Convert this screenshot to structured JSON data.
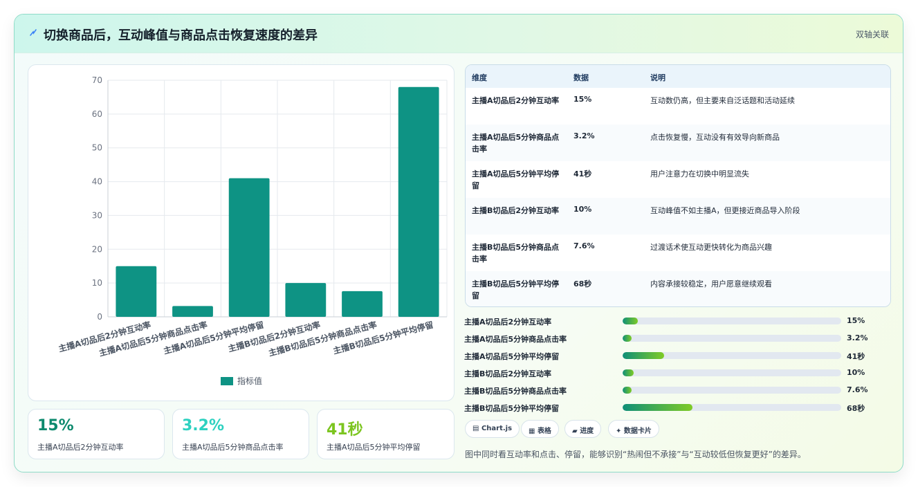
{
  "header": {
    "title": "切换商品后，互动峰值与商品点击恢复速度的差异",
    "tag": "双轴关联"
  },
  "chart_data": {
    "type": "bar",
    "categories": [
      "主播A切品后2分钟互动率",
      "主播A切品后5分钟商品点击率",
      "主播A切品后5分钟平均停留",
      "主播B切品后2分钟互动率",
      "主播B切品后5分钟商品点击率",
      "主播B切品后5分钟平均停留"
    ],
    "series": [
      {
        "name": "指标值",
        "values": [
          15,
          3.2,
          41,
          10,
          7.6,
          68
        ]
      }
    ],
    "ylim": [
      0,
      70
    ],
    "yticks": [
      0,
      10,
      20,
      30,
      40,
      50,
      60,
      70
    ],
    "grid": true,
    "legend": "bottom",
    "color": "#0e9384"
  },
  "stats": [
    {
      "value": "15%",
      "label": "主播A切品后2分钟互动率",
      "color": "#0e8a6e"
    },
    {
      "value": "3.2%",
      "label": "主播A切品后5分钟商品点击率",
      "color": "#2ed1c0"
    },
    {
      "value": "41秒",
      "label": "主播A切品后5分钟平均停留",
      "color": "#7cc520"
    }
  ],
  "table": {
    "headers": [
      "维度",
      "数据",
      "说明"
    ],
    "rows": [
      {
        "dim": "主播A切品后2分钟互动率",
        "data": "15%",
        "desc": "互动数仍高，但主要来自泛话题和活动延续"
      },
      {
        "dim": "主播A切品后5分钟商品点击率",
        "data": "3.2%",
        "desc": "点击恢复慢，互动没有有效导向新商品"
      },
      {
        "dim": "主播A切品后5分钟平均停留",
        "data": "41秒",
        "desc": "用户注意力在切换中明显流失"
      },
      {
        "dim": "主播B切品后2分钟互动率",
        "data": "10%",
        "desc": "互动峰值不如主播A，但更接近商品导入阶段"
      },
      {
        "dim": "主播B切品后5分钟商品点击率",
        "data": "7.6%",
        "desc": "过渡话术使互动更快转化为商品兴趣"
      },
      {
        "dim": "主播B切品后5分钟平均停留",
        "data": "68秒",
        "desc": "内容承接较稳定，用户愿意继续观看"
      }
    ]
  },
  "progress": [
    {
      "label": "主播A切品后2分钟互动率",
      "value": "15%",
      "fraction": 0.07
    },
    {
      "label": "主播A切品后5分钟商品点击率",
      "value": "3.2%",
      "fraction": 0.04
    },
    {
      "label": "主播A切品后5分钟平均停留",
      "value": "41秒",
      "fraction": 0.19
    },
    {
      "label": "主播B切品后2分钟互动率",
      "value": "10%",
      "fraction": 0.05
    },
    {
      "label": "主播B切品后5分钟商品点击率",
      "value": "7.6%",
      "fraction": 0.04
    },
    {
      "label": "主播B切品后5分钟平均停留",
      "value": "68秒",
      "fraction": 0.32
    }
  ],
  "chips": [
    {
      "icon": "▤",
      "label": "Chart.js"
    },
    {
      "icon": "▦",
      "label": "表格"
    },
    {
      "icon": "▰",
      "label": "进度"
    },
    {
      "icon": "✦",
      "label": "数据卡片"
    }
  ],
  "note": "图中同时看互动率和点击、停留，能够识别“热闹但不承接”与“互动较低但恢复更好”的差异。"
}
